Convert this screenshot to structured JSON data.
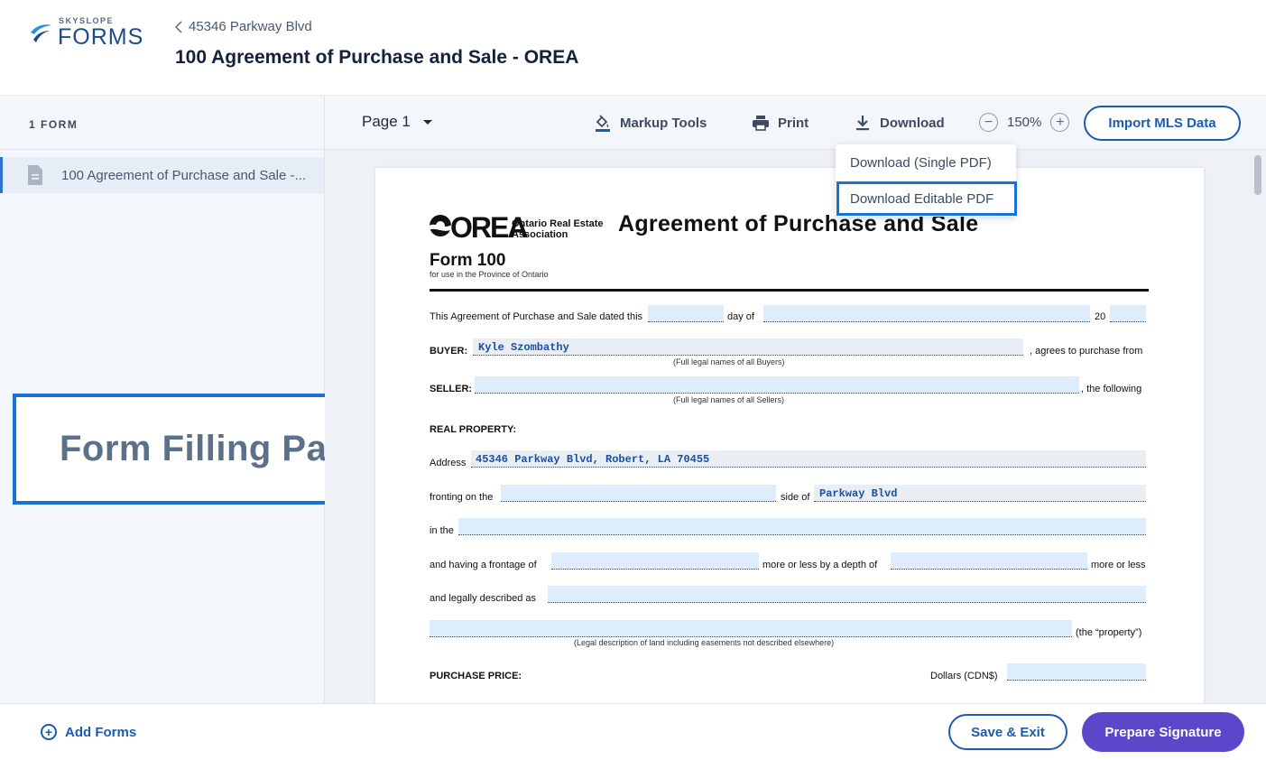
{
  "header": {
    "brand_top": "SKYSLOPE",
    "brand_main": "FORMS",
    "breadcrumb": "45346 Parkway Blvd",
    "title": "100 Agreement of Purchase and Sale - OREA"
  },
  "sidebar": {
    "heading": "1 FORM",
    "items": [
      {
        "label": "100 Agreement of Purchase and Sale -...",
        "icon": "document-icon"
      }
    ]
  },
  "callout": {
    "text": "Form Filling Page"
  },
  "toolbar": {
    "page_label": "Page 1",
    "markup_tools": "Markup Tools",
    "print": "Print",
    "download": "Download",
    "zoom": "150%",
    "import_mls": "Import MLS Data"
  },
  "download_menu": {
    "items": [
      "Download (Single PDF)",
      "Download Editable PDF"
    ],
    "highlighted": "Download Editable PDF"
  },
  "document": {
    "org_short": "OREA",
    "org_name": "Ontario Real Estate Association",
    "title": "Agreement of Purchase and Sale",
    "form_number": "Form 100",
    "form_subtitle": "for use in the Province of Ontario",
    "dated_prefix": "This Agreement of Purchase and Sale dated this",
    "dated_day_of": "day of",
    "dated_year": "20",
    "buyer_label": "BUYER:",
    "buyer_value": "Kyle Szombathy",
    "buyer_suffix": ", agrees to purchase from",
    "buyer_note": "(Full legal names of all Buyers)",
    "seller_label": "SELLER:",
    "seller_suffix": ", the following",
    "seller_note": "(Full legal names of all Sellers)",
    "real_property_label": "REAL PROPERTY:",
    "address_label": "Address",
    "address_value": "45346 Parkway Blvd, Robert, LA 70455",
    "fronting_label": "fronting on the",
    "side_of_label": "side of",
    "side_of_value": "Parkway Blvd",
    "in_the_label": "in the",
    "frontage_label": "and having a frontage of",
    "depth_label": "more or less by a depth of",
    "more_or_less": "more or less",
    "legal_label": "and legally described as",
    "property_suffix": "(the “property”)",
    "legal_note": "(Legal description of land including easements not described elsewhere)",
    "purchase_price_label": "PURCHASE PRICE:",
    "dollars_label": "Dollars (CDN$)"
  },
  "footer": {
    "add_forms": "Add Forms",
    "save_exit": "Save & Exit",
    "prepare_signature": "Prepare Signature"
  },
  "colors": {
    "primary": "#1c5bb0",
    "accent_purple": "#5a47c9",
    "highlight_blue": "#1a72d9",
    "field_fill": "#deedfb"
  }
}
